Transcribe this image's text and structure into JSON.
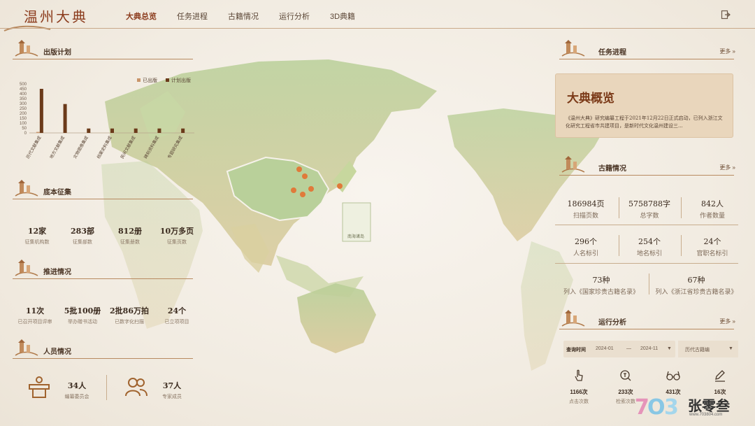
{
  "header": {
    "logo": "温州大典",
    "nav": [
      {
        "label": "大典总览",
        "active": true
      },
      {
        "label": "任务进程"
      },
      {
        "label": "古籍情况"
      },
      {
        "label": "运行分析"
      },
      {
        "label": "3D典籍"
      }
    ]
  },
  "publish": {
    "title": "出版计划",
    "legend": [
      "已出版",
      "计划出版"
    ]
  },
  "chart_data": {
    "type": "bar",
    "categories": [
      "历代文献集成",
      "地方文献集成",
      "文物图像集成",
      "档案史料集成",
      "民间文献集成",
      "碑刻资料集成",
      "专题研究集成"
    ],
    "series": [
      {
        "name": "已出版",
        "values": [
          10,
          0,
          0,
          0,
          0,
          0,
          0
        ],
        "color": "#c9956a"
      },
      {
        "name": "计划出版",
        "values": [
          450,
          295,
          45,
          45,
          45,
          45,
          45
        ],
        "color": "#6b3a1a"
      }
    ],
    "ylim": [
      0,
      500
    ],
    "yticks": [
      0,
      50,
      100,
      150,
      200,
      250,
      300,
      350,
      400,
      450,
      500
    ]
  },
  "collect": {
    "title": "底本征集",
    "items": [
      {
        "value": "12家",
        "label": "征集机构数"
      },
      {
        "value": "283部",
        "label": "征集部数"
      },
      {
        "value": "812册",
        "label": "征集册数"
      },
      {
        "value": "10万多页",
        "label": "征集页数"
      }
    ]
  },
  "progress": {
    "title": "推进情况",
    "items": [
      {
        "value": "11次",
        "label": "已召开项目评审"
      },
      {
        "value": "5批100册",
        "label": "举办赠书活动"
      },
      {
        "value": "2批86万拍",
        "label": "已数字化扫描"
      },
      {
        "value": "24个",
        "label": "已立项项目"
      }
    ]
  },
  "staff": {
    "title": "人员情况",
    "items": [
      {
        "value": "34人",
        "label": "编纂委员会"
      },
      {
        "value": "37人",
        "label": "专家成员"
      }
    ]
  },
  "task": {
    "title": "任务进程",
    "more": "更多"
  },
  "overview": {
    "title": "大典概览",
    "desc": "《温州大典》研究编纂工程于2021年12月22日正式启动，已列入浙江文化研究工程省市共建项目，是新时代文化温州建设三..."
  },
  "ancient": {
    "title": "古籍情况",
    "more": "更多",
    "row1": [
      {
        "value": "186984页",
        "label": "扫描页数"
      },
      {
        "value": "5758788字",
        "label": "总字数"
      },
      {
        "value": "842人",
        "label": "作者数量"
      }
    ],
    "row2": [
      {
        "value": "296个",
        "label": "人名标引"
      },
      {
        "value": "254个",
        "label": "地名标引"
      },
      {
        "value": "24个",
        "label": "官职名标引"
      }
    ],
    "row3": [
      {
        "value": "73种",
        "label": "列入《国家珍贵古籍名录》"
      },
      {
        "value": "67种",
        "label": "列入《浙江省珍贵古籍名录》"
      }
    ]
  },
  "analysis": {
    "title": "运行分析",
    "more": "更多",
    "query_label": "查询时间",
    "from": "2024-01",
    "dash": "—",
    "to": "2024-11",
    "select": "历代古籍编",
    "ops": [
      {
        "value": "1166次",
        "label": "点击次数"
      },
      {
        "value": "233次",
        "label": "检索次数"
      },
      {
        "value": "431次",
        "label": ""
      },
      {
        "value": "16次",
        "label": ""
      }
    ]
  },
  "map": {
    "inset_label": "南海诸岛"
  },
  "watermark": {
    "brand": "张零叁",
    "url": "www.703804.com"
  }
}
